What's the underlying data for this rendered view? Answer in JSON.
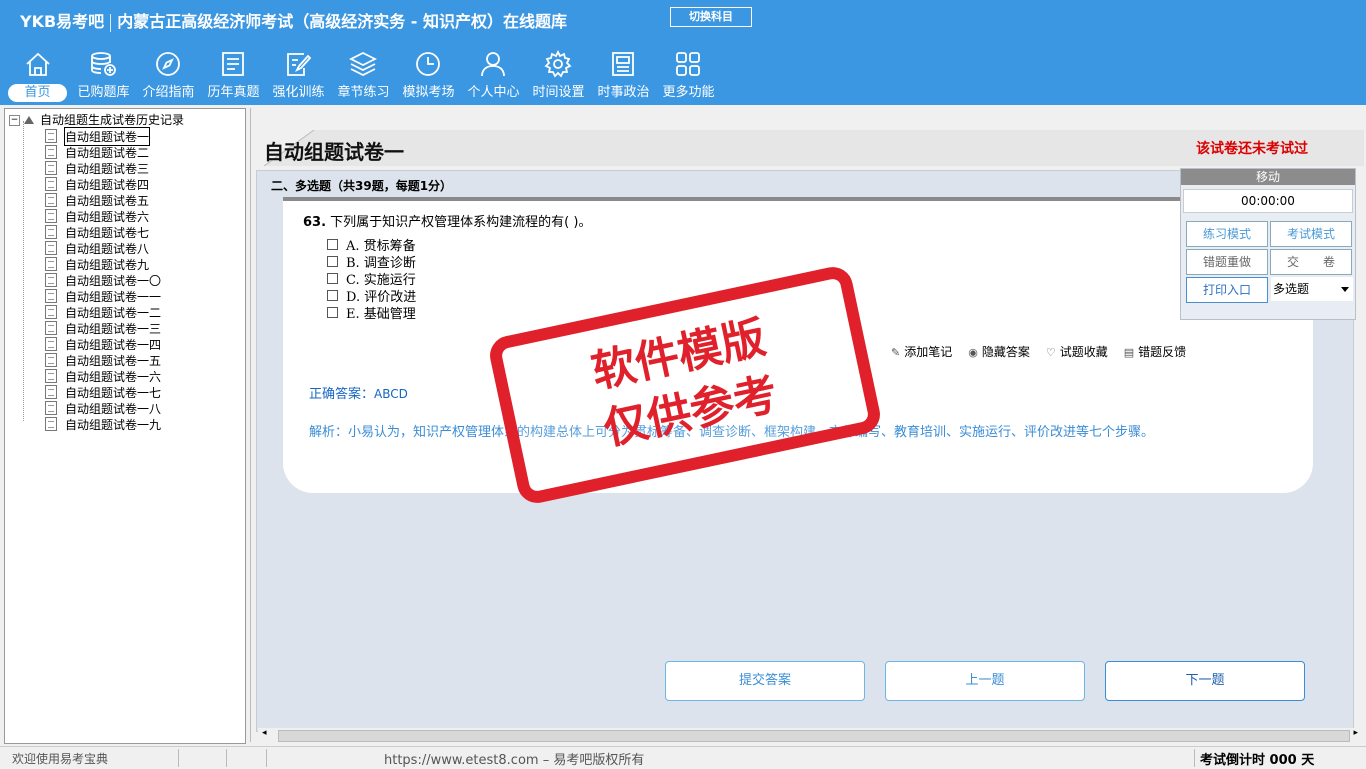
{
  "header": {
    "brand": "YKB易考吧",
    "title": "内蒙古正高级经济师考试（高级经济实务 - 知识产权）在线题库",
    "switch_label": "切换科目"
  },
  "nav": [
    {
      "label": "首页",
      "icon": "home-icon"
    },
    {
      "label": "已购题库",
      "icon": "database-icon"
    },
    {
      "label": "介绍指南",
      "icon": "compass-icon"
    },
    {
      "label": "历年真题",
      "icon": "list-icon"
    },
    {
      "label": "强化训练",
      "icon": "edit-icon"
    },
    {
      "label": "章节练习",
      "icon": "layers-icon"
    },
    {
      "label": "模拟考场",
      "icon": "clock-icon"
    },
    {
      "label": "个人中心",
      "icon": "user-icon"
    },
    {
      "label": "时间设置",
      "icon": "gear-icon"
    },
    {
      "label": "时事政治",
      "icon": "news-icon"
    },
    {
      "label": "更多功能",
      "icon": "grid-icon"
    }
  ],
  "tree": {
    "root": "自动组题生成试卷历史记录",
    "items": [
      "自动组题试卷一",
      "自动组题试卷二",
      "自动组题试卷三",
      "自动组题试卷四",
      "自动组题试卷五",
      "自动组题试卷六",
      "自动组题试卷七",
      "自动组题试卷八",
      "自动组题试卷九",
      "自动组题试卷一〇",
      "自动组题试卷一一",
      "自动组题试卷一二",
      "自动组题试卷一三",
      "自动组题试卷一四",
      "自动组题试卷一五",
      "自动组题试卷一六",
      "自动组题试卷一七",
      "自动组题试卷一八",
      "自动组题试卷一九"
    ]
  },
  "paper": {
    "title": "自动组题试卷一",
    "status": "该试卷还未考试过",
    "section": "二、多选题（共39题，每题1分）",
    "question_no": "63.",
    "question": "下列属于知识产权管理体系构建流程的有( )。",
    "options": [
      "A. 贯标筹备",
      "B. 调查诊断",
      "C. 实施运行",
      "D. 评价改进",
      "E. 基础管理"
    ],
    "tools": [
      "添加笔记",
      "隐藏答案",
      "试题收藏",
      "错题反馈"
    ],
    "answer_label": "正确答案：",
    "answer_value": "ABCD",
    "analysis": "解析：小易认为，知识产权管理体系的构建总体上可分为贯标筹备、调查诊断、框架构建、文件编写、教育培训、实施运行、评价改进等七个步骤。",
    "buttons": {
      "submit": "提交答案",
      "prev": "上一题",
      "next": "下一题"
    }
  },
  "panel": {
    "move": "移动",
    "timer": "00:00:00",
    "practice": "练习模式",
    "exam": "考试模式",
    "redo": "错题重做",
    "hand_in": "交　　卷",
    "print": "打印入口",
    "type_select": "多选题"
  },
  "watermark": {
    "line1": "软件模版",
    "line2": "仅供参考"
  },
  "statusbar": {
    "welcome": "欢迎使用易考宝典",
    "url": "https://www.etest8.com – 易考吧版权所有",
    "countdown": "考试倒计时 000 天"
  },
  "colors": {
    "header": "#3c97e2",
    "status_red": "#dd0000",
    "answer_blue": "#1666c4",
    "stamp_red": "#e0202a"
  }
}
